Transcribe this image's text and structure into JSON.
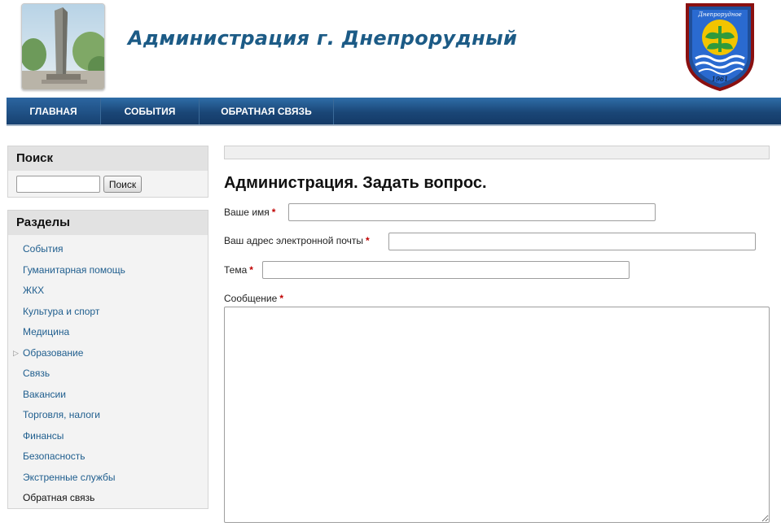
{
  "header": {
    "site_title": "Администрация г. Днепрорудный",
    "coat_of_arms_text": "Днепрорудное",
    "coat_of_arms_year": "1961"
  },
  "nav": {
    "items": [
      "ГЛАВНАЯ",
      "СОБЫТИЯ",
      "ОБРАТНАЯ СВЯЗЬ"
    ]
  },
  "search": {
    "title": "Поиск",
    "input_value": "",
    "button_label": "Поиск"
  },
  "sections": {
    "title": "Разделы",
    "items": [
      {
        "label": "События",
        "expandable": false,
        "active": false
      },
      {
        "label": "Гуманитарная помощь",
        "expandable": false,
        "active": false
      },
      {
        "label": "ЖКХ",
        "expandable": false,
        "active": false
      },
      {
        "label": "Культура и спорт",
        "expandable": false,
        "active": false
      },
      {
        "label": "Медицина",
        "expandable": false,
        "active": false
      },
      {
        "label": "Образование",
        "expandable": true,
        "active": false
      },
      {
        "label": "Связь",
        "expandable": false,
        "active": false
      },
      {
        "label": "Вакансии",
        "expandable": false,
        "active": false
      },
      {
        "label": "Торговля, налоги",
        "expandable": false,
        "active": false
      },
      {
        "label": "Финансы",
        "expandable": false,
        "active": false
      },
      {
        "label": "Безопасность",
        "expandable": false,
        "active": false
      },
      {
        "label": "Экстренные службы",
        "expandable": false,
        "active": false
      },
      {
        "label": "Обратная связь",
        "expandable": false,
        "active": true
      }
    ]
  },
  "form": {
    "title": "Администрация. Задать вопрос.",
    "required_mark": "*",
    "name_label": "Ваше имя",
    "name_value": "",
    "email_label": "Ваш адрес электронной почты",
    "email_value": "",
    "subject_label": "Тема",
    "subject_value": "",
    "message_label": "Сообщение",
    "message_value": ""
  },
  "colors": {
    "title_blue": "#1c5b86",
    "nav_blue": "#1a4677",
    "link_blue": "#1f5e8e",
    "required_red": "#c00000"
  }
}
